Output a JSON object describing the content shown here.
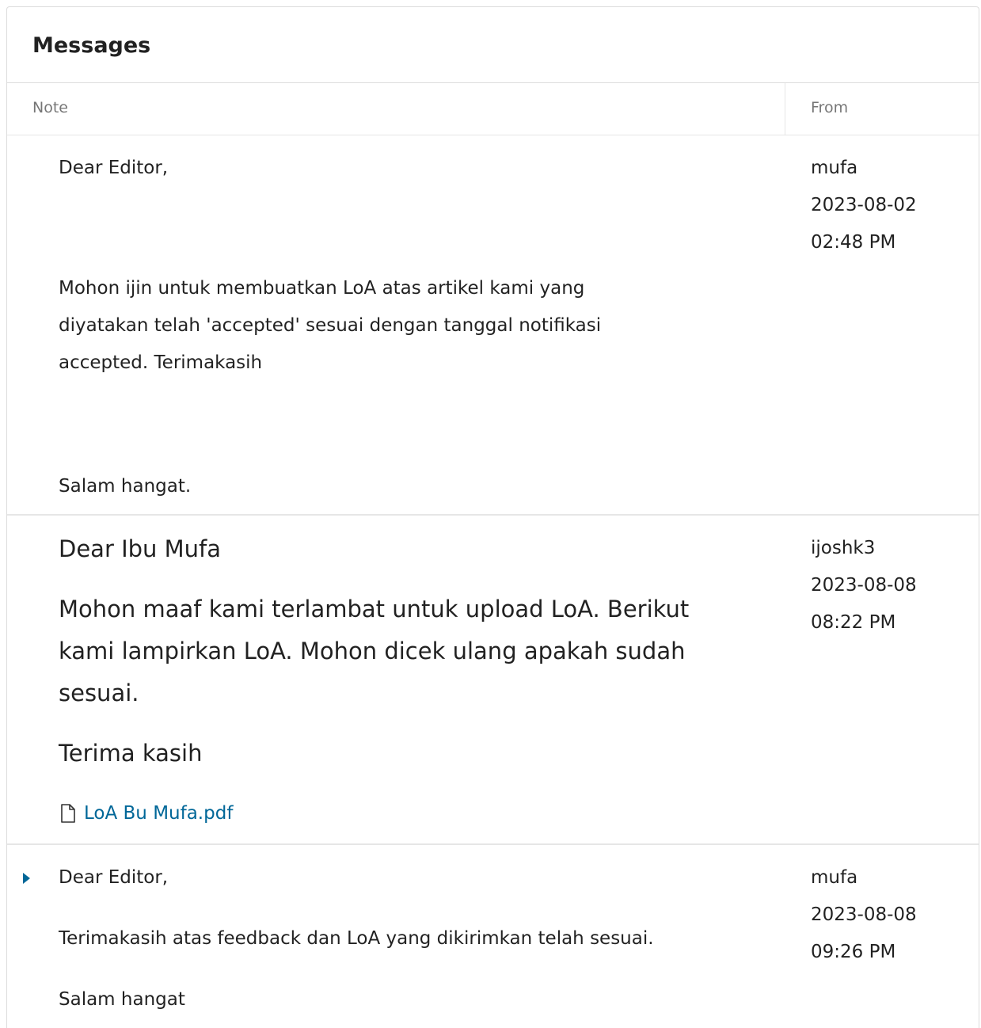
{
  "panel": {
    "title": "Messages",
    "columns": {
      "note": "Note",
      "from": "From"
    }
  },
  "colors": {
    "link": "#006798",
    "border": "#dddddd"
  },
  "messages": [
    {
      "paragraphs": [
        "Dear Editor,",
        "Mohon ijin untuk membuatkan LoA atas artikel kami yang",
        "diyatakan telah 'accepted' sesuai dengan tanggal notifikasi",
        "accepted. Terimakasih",
        "Salam hangat."
      ],
      "from": "mufa",
      "date": "2023-08-02",
      "time": "02:48 PM"
    },
    {
      "paragraphs": [
        "Dear Ibu Mufa",
        "Mohon maaf kami terlambat untuk upload LoA. Berikut",
        "kami lampirkan LoA. Mohon dicek ulang apakah sudah",
        "sesuai.",
        "Terima kasih"
      ],
      "attachment": {
        "icon": "file-icon",
        "name": "LoA Bu Mufa.pdf"
      },
      "from": "ijoshk3",
      "date": "2023-08-08",
      "time": "08:22 PM"
    },
    {
      "paragraphs": [
        "Dear Editor,",
        "Terimakasih atas feedback dan LoA yang dikirimkan telah sesuai.",
        "Salam hangat"
      ],
      "toggle_icon": "caret-right-icon",
      "from": "mufa",
      "date": "2023-08-08",
      "time": "09:26 PM"
    }
  ]
}
